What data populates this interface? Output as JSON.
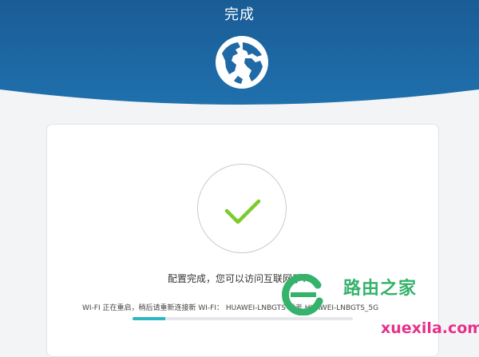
{
  "header": {
    "title": "完成",
    "icon": "globe-icon"
  },
  "card": {
    "status_icon": "checkmark-icon",
    "success_message": "配置完成，您可以访问互联网了！",
    "reconnect": {
      "prefix": "WI-FI 正在重启，稍后请重新连接新 WI-FI：",
      "ssid_24": "HUAWEI-LNBGTS",
      "separator": "或者",
      "ssid_5g": "HUAWEI-LNBGTS_5G"
    },
    "progress": 0.15
  },
  "watermark": {
    "brand": "路由之家",
    "site": "xuexila.com"
  },
  "colors": {
    "header": "#1a5f99",
    "accent": "#2fb6c3",
    "check": "#7ccb2c",
    "watermark_green": "#35b26b",
    "watermark_pink": "#e7308a"
  }
}
